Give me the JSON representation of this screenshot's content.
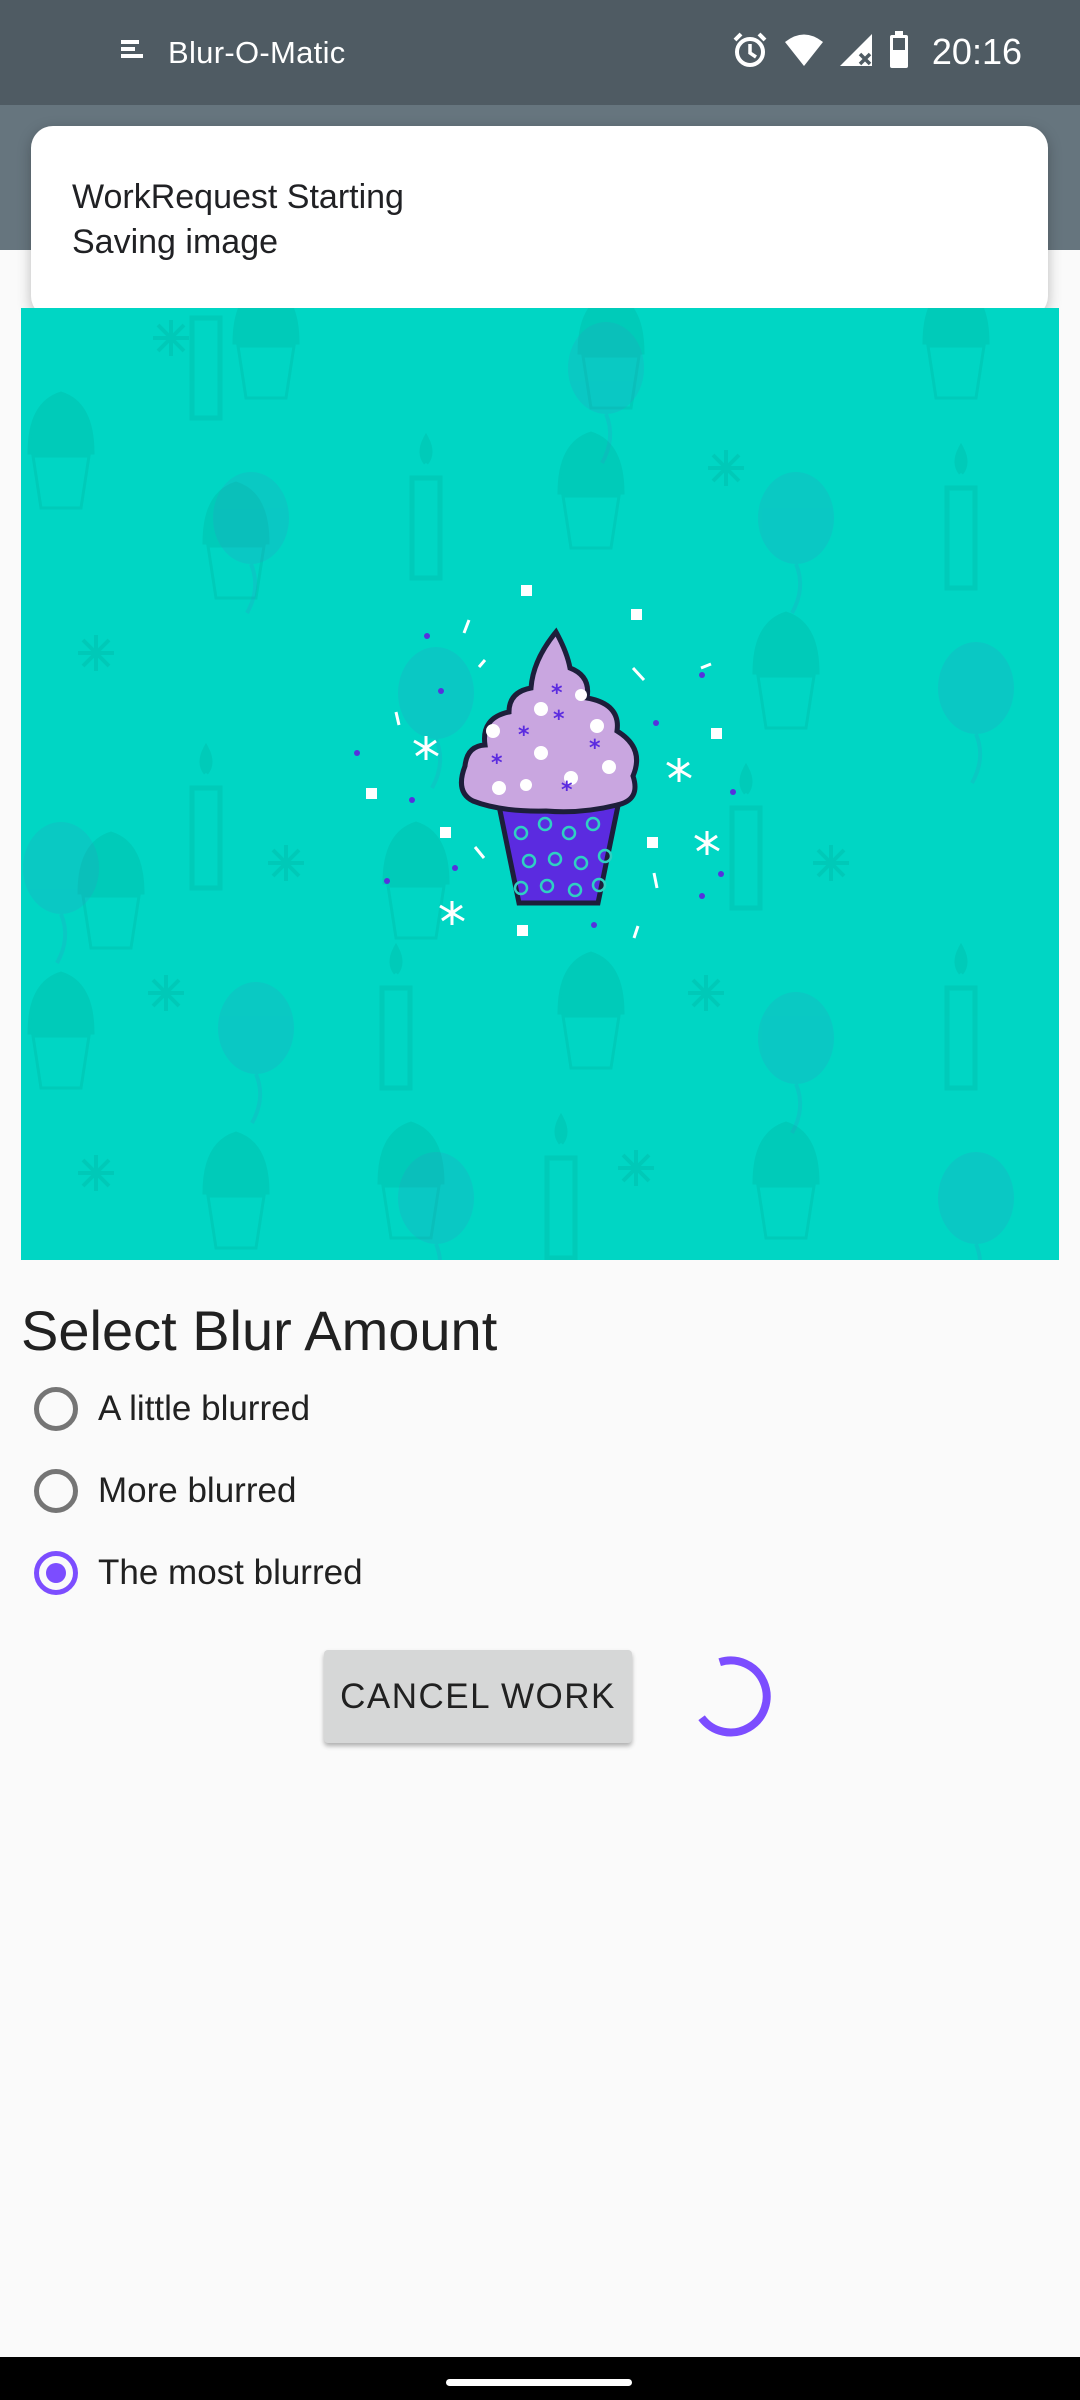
{
  "status_bar": {
    "app_name": "Blur-O-Matic",
    "time": "20:16",
    "icons": [
      "app-notification-icon",
      "alarm-icon",
      "wifi-icon",
      "signal-icon",
      "battery-icon"
    ]
  },
  "notification": {
    "title": "WorkRequest Starting",
    "text": "Saving image"
  },
  "image": {
    "description_icon": "cupcake-image",
    "background_color": "#00d6c4"
  },
  "blur_selector": {
    "title": "Select Blur Amount",
    "options": [
      {
        "label": "A little blurred",
        "selected": false
      },
      {
        "label": "More blurred",
        "selected": false
      },
      {
        "label": "The most blurred",
        "selected": true
      }
    ]
  },
  "actions": {
    "cancel_label": "CANCEL WORK",
    "progress_icon": "progress-spinner-icon"
  },
  "colors": {
    "accent": "#7c4dff",
    "status_bar": "#4f5b63"
  }
}
